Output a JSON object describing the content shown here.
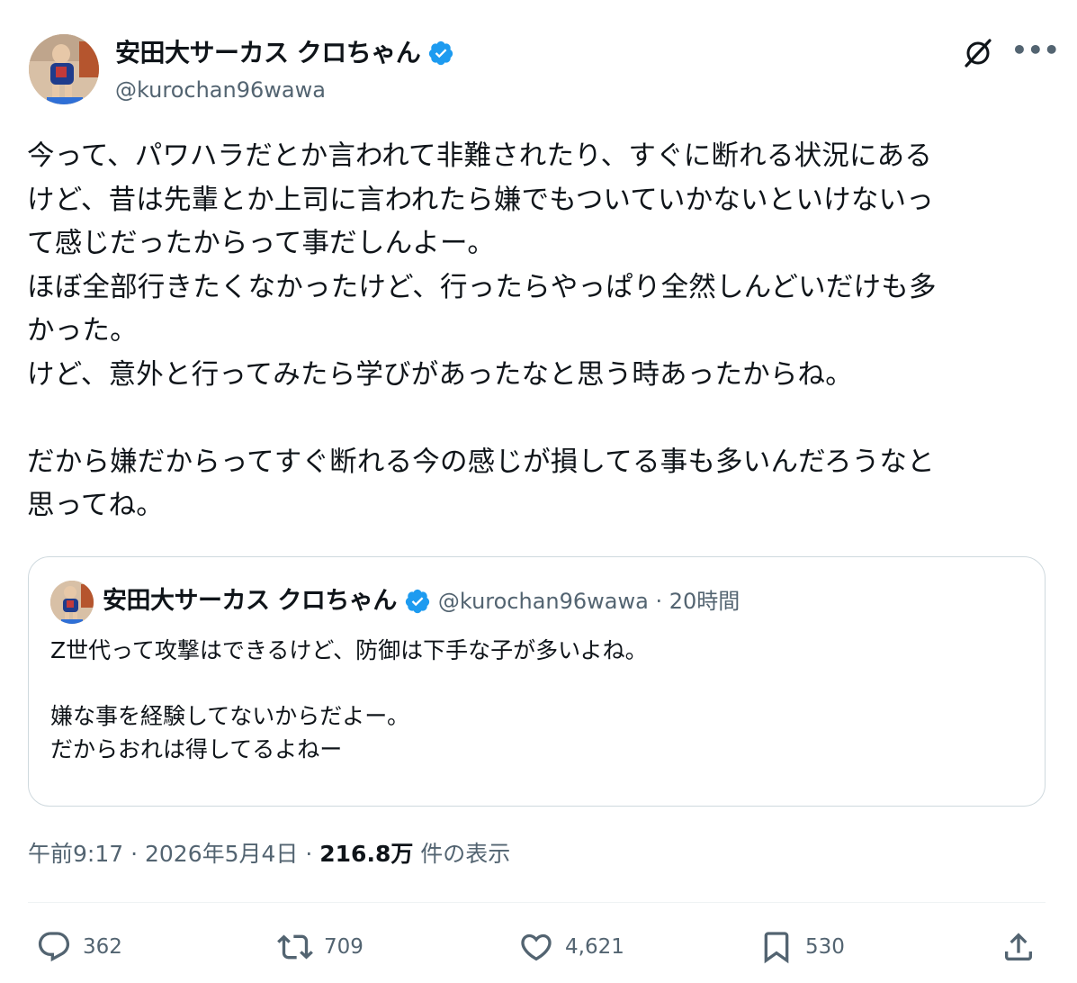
{
  "author": {
    "display_name": "安田大サーカス クロちゃん",
    "handle": "@kurochan96wawa",
    "verified_color": "#1d9bf0",
    "avatar_icon": "profile-photo"
  },
  "header_icons": {
    "grok": "grok-icon",
    "more": "•••"
  },
  "post": {
    "text": "今って、パワハラだとか言われて非難されたり、すぐに断れる状況にある\nけど、昔は先輩とか上司に言われたら嫌でもついていかないといけないっ\nて感じだったからって事だしんよー。\nほぼ全部行きたくなかったけど、行ったらやっぱり全然しんどいだけも多\nかった。\nけど、意外と行ってみたら学びがあったなと思う時あったからね。\n\nだから嫌だからってすぐ断れる今の感じが損してる事も多いんだろうなと\n思ってね。"
  },
  "quote": {
    "display_name": "安田大サーカス クロちゃん",
    "meta": "@kurochan96wawa · 20時間",
    "text": "Z世代って攻撃はできるけど、防御は下手な子が多いよね。\n\n嫌な事を経験してないからだよー。\nだからおれは得してるよねー"
  },
  "meta": {
    "time_date": "午前9:17 · 2026年5月4日 · ",
    "views_count": "216.8万",
    "views_label": " 件の表示"
  },
  "actions": {
    "replies": "362",
    "reposts": "709",
    "likes": "4,621",
    "bookmarks": "530"
  }
}
